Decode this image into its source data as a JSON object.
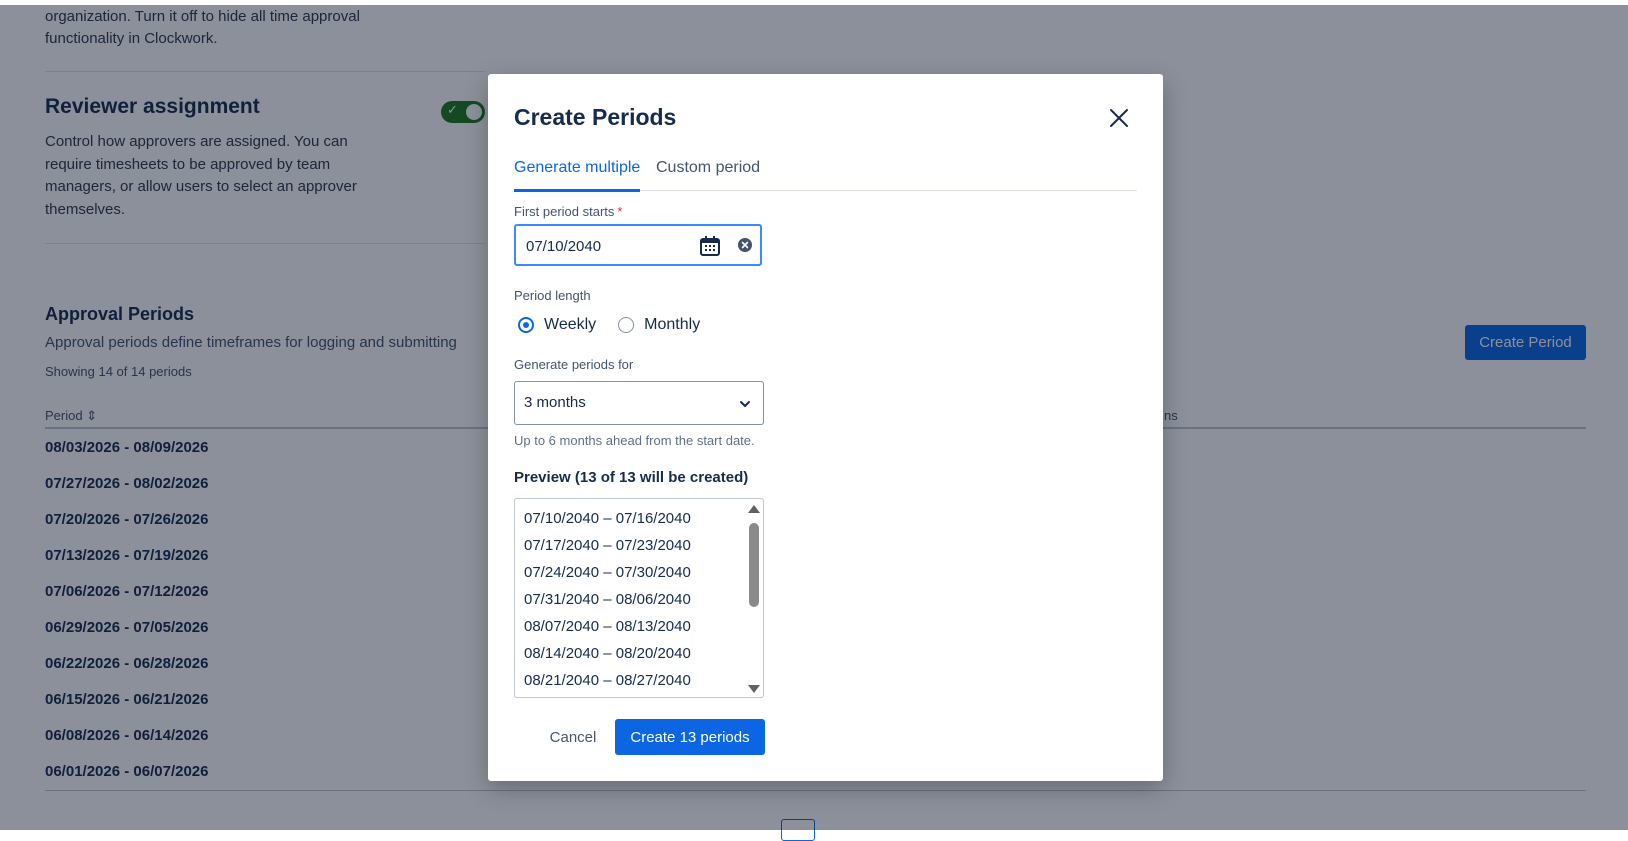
{
  "background": {
    "intro_line1": "organization. Turn it off to hide all time approval",
    "intro_line2": "functionality in Clockwork.",
    "reviewer": {
      "title": "Reviewer assignment",
      "desc_line1": "Control how approvers are assigned. You can",
      "desc_line2": "require timesheets to be approved by team",
      "desc_line3": "managers, or allow users to select an approver",
      "desc_line4": "themselves.",
      "toggle_on": true
    },
    "approval_periods": {
      "title": "Approval Periods",
      "description": "Approval periods define timeframes for logging and submitting",
      "count": "Showing 14 of 14 periods",
      "create_button": "Create Period",
      "col_period": "Period ⇕",
      "col_actions_fragment": "ns",
      "rows": [
        "08/03/2026 - 08/09/2026",
        "07/27/2026 - 08/02/2026",
        "07/20/2026 - 07/26/2026",
        "07/13/2026 - 07/19/2026",
        "07/06/2026 - 07/12/2026",
        "06/29/2026 - 07/05/2026",
        "06/22/2026 - 06/28/2026",
        "06/15/2026 - 06/21/2026",
        "06/08/2026 - 06/14/2026",
        "06/01/2026 - 06/07/2026"
      ]
    }
  },
  "modal": {
    "title": "Create Periods",
    "close_icon": "close-icon",
    "tabs": [
      {
        "label": "Generate multiple",
        "active": true
      },
      {
        "label": "Custom period",
        "active": false
      }
    ],
    "first_period": {
      "label": "First period starts",
      "required_mark": "*",
      "value": "07/10/2040"
    },
    "period_length": {
      "label": "Period length",
      "options": [
        {
          "label": "Weekly",
          "selected": true
        },
        {
          "label": "Monthly",
          "selected": false
        }
      ]
    },
    "generate_for": {
      "label": "Generate periods for",
      "value": "3 months",
      "hint": "Up to 6 months ahead from the start date."
    },
    "preview": {
      "title": "Preview (13 of 13 will be created)",
      "items": [
        "07/10/2040 – 07/16/2040",
        "07/17/2040 – 07/23/2040",
        "07/24/2040 – 07/30/2040",
        "07/31/2040 – 08/06/2040",
        "08/07/2040 – 08/13/2040",
        "08/14/2040 – 08/20/2040",
        "08/21/2040 – 08/27/2040"
      ]
    },
    "cancel_label": "Cancel",
    "submit_label": "Create 13 periods"
  },
  "colors": {
    "accent": "#0c66e4",
    "toggle_on": "#1f7a1f",
    "overlay": "rgba(9,20,40,0.47)",
    "required": "#c9372c"
  }
}
